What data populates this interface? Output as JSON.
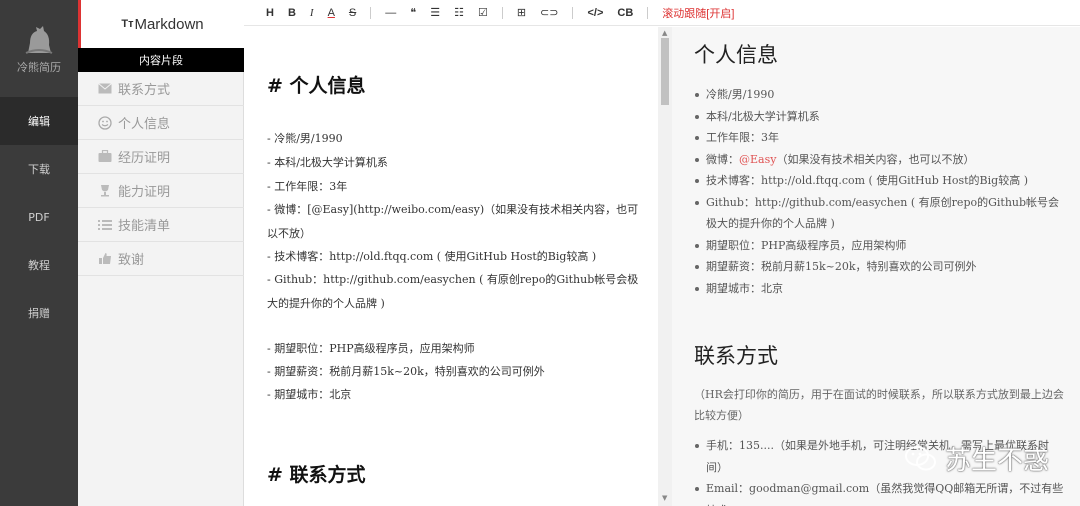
{
  "app": {
    "brand": "冷熊简历"
  },
  "nav": {
    "items": [
      "编辑",
      "下载",
      "PDF",
      "教程",
      "捐赠"
    ],
    "active_index": 0
  },
  "sidebar": {
    "title_prefix": "Tт",
    "title": "Markdown",
    "section": "内容片段",
    "items": [
      {
        "label": "联系方式",
        "icon": "envelope-icon"
      },
      {
        "label": "个人信息",
        "icon": "smile-icon"
      },
      {
        "label": "经历证明",
        "icon": "briefcase-icon"
      },
      {
        "label": "能力证明",
        "icon": "trophy-icon"
      },
      {
        "label": "技能清单",
        "icon": "list-icon"
      },
      {
        "label": "致谢",
        "icon": "thumbs-up-icon"
      }
    ]
  },
  "toolbar": {
    "buttons": [
      "H",
      "B",
      "I",
      "A",
      "S",
      "—",
      "❝",
      "☰",
      "☷",
      "☑",
      "⊞",
      "⊂⊃",
      "</>",
      "CB"
    ],
    "scroll_sync": "滚动跟随[开启]"
  },
  "editor": {
    "heading1": "# 个人信息",
    "lines": [
      "- 冷熊/男/1990",
      "- 本科/北极大学计算机系",
      "- 工作年限：3年",
      "- 微博：[@Easy](http://weibo.com/easy)（如果没有技术相关内容，也可以不放）",
      "- 技术博客：http://old.ftqq.com ( 使用GitHub Host的Big较高 )",
      "- Github：http://github.com/easychen ( 有原创repo的Github帐号会极大的提升你的个人品牌 )",
      "- 期望职位：PHP高级程序员，应用架构师",
      "- 期望薪资：税前月薪15k~20k，特别喜欢的公司可例外",
      "- 期望城市：北京"
    ],
    "heading2": "# 联系方式"
  },
  "preview": {
    "heading1": "个人信息",
    "weibo_prefix": "微博：",
    "weibo_link": "@Easy",
    "weibo_suffix": "（如果没有技术相关内容，也可以不放）",
    "items": [
      "冷熊/男/1990",
      "本科/北极大学计算机系",
      "工作年限：3年",
      "技术博客：http://old.ftqq.com ( 使用GitHub Host的Big较高 )",
      "Github：http://github.com/easychen ( 有原创repo的Github帐号会极大的提升你的个人品牌 )",
      "期望职位：PHP高级程序员，应用架构师",
      "期望薪资：税前月薪15k~20k，特别喜欢的公司可例外",
      "期望城市：北京"
    ],
    "heading2": "联系方式",
    "note": "（HR会打印你的简历，用于在面试的时候联系，所以联系方式放到最上边会比较方便）",
    "contact_items": [
      "手机：135....（如果是外地手机，可注明经常关机，需写上最优联系时间）",
      "Email：goodman@gmail.com（虽然我觉得QQ邮箱无所谓，不过有些技术"
    ]
  },
  "watermark": {
    "text": "苏生不惑",
    "icon": "wechat-icon"
  }
}
